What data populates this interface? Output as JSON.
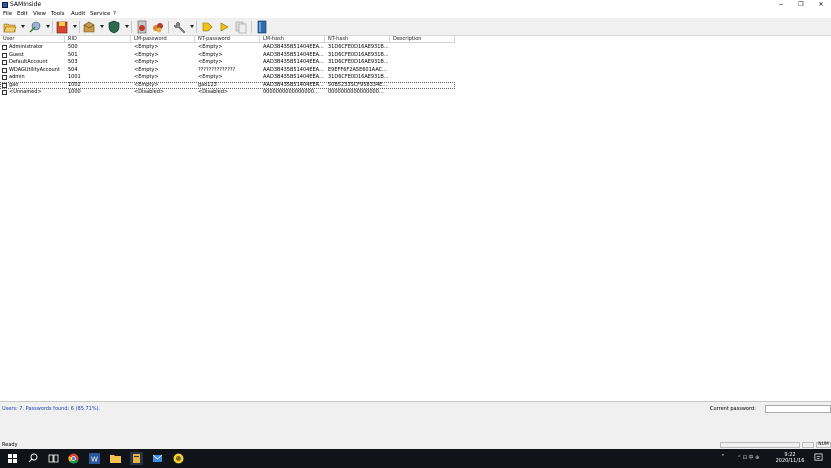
{
  "window": {
    "title": "SAMInside",
    "minimize": "−",
    "maximize": "❐",
    "close": "✕"
  },
  "menu": {
    "file": "File",
    "edit": "Edit",
    "view": "View",
    "tools": "Tools",
    "audit": "Audit",
    "service": "Service",
    "help": "?"
  },
  "toolbar": {
    "icons": [
      "open-folder-icon",
      "import-icon",
      "sam-file-icon",
      "export-icon",
      "attack-icon",
      "users-icon",
      "keys-icon",
      "tools-icon",
      "key-icon",
      "play-icon",
      "copy-icon",
      "help-book-icon"
    ]
  },
  "table": {
    "columns": [
      "User",
      "RID",
      "LM-password",
      "NT-password",
      "LM-hash",
      "NT-hash",
      "Description"
    ],
    "rows": [
      {
        "user": "Administrator",
        "rid": "500",
        "lm_password": "<Empty>",
        "nt_password": "<Empty>",
        "lm_hash": "AAD3B435B51404EEA...",
        "nt_hash": "31D6CFE0D16AE931B...",
        "description": ""
      },
      {
        "user": "Guest",
        "rid": "501",
        "lm_password": "<Empty>",
        "nt_password": "<Empty>",
        "lm_hash": "AAD3B435B51404EEA...",
        "nt_hash": "31D6CFE0D16AE931B...",
        "description": ""
      },
      {
        "user": "DefaultAccount",
        "rid": "503",
        "lm_password": "<Empty>",
        "nt_password": "<Empty>",
        "lm_hash": "AAD3B435B51404EEA...",
        "nt_hash": "31D6CFE0D16AE931B...",
        "description": ""
      },
      {
        "user": "WDAGUtilityAccount",
        "rid": "504",
        "lm_password": "<Empty>",
        "nt_password": "??????????????",
        "lm_hash": "AAD3B435B51404EEA...",
        "nt_hash": "E9EFF6F2A5E601AAC...",
        "description": ""
      },
      {
        "user": "admin",
        "rid": "1001",
        "lm_password": "<Empty>",
        "nt_password": "<Empty>",
        "lm_hash": "AAD3B435B51404EEA...",
        "nt_hash": "31D6CFE0D16AE931B...",
        "description": ""
      },
      {
        "user": "gao",
        "rid": "1002",
        "lm_password": "<Empty>",
        "nt_password": "gao123",
        "lm_hash": "AAD3B435B51404EEA...",
        "nt_hash": "50B5233SCF958334E...",
        "description": ""
      },
      {
        "user": "<Unnamed>",
        "rid": "1000",
        "lm_password": "<Disabled>",
        "nt_password": "<Disabled>",
        "lm_hash": "0000000000000000...",
        "nt_hash": "0000000000000000...",
        "description": ""
      }
    ]
  },
  "status": {
    "summary": "Users: 7. Passwords found: 6 (85.71%).",
    "current_password_label": "Current password:",
    "current_password_value": "",
    "ready": "Ready",
    "num": "NUM"
  },
  "taskbar": {
    "apps": [
      "start-icon",
      "search-icon",
      "task-view-icon",
      "chrome-icon",
      "word-icon",
      "file-explorer-icon",
      "saminside-icon",
      "mail-icon",
      "other-app-icon"
    ],
    "tray_text": "⌃ ⊡ 中 ⊕",
    "time": "9:22",
    "date": "2020/11/16"
  },
  "colors": {
    "summary_text": "#1a3fb0",
    "taskbar": "#101418"
  }
}
